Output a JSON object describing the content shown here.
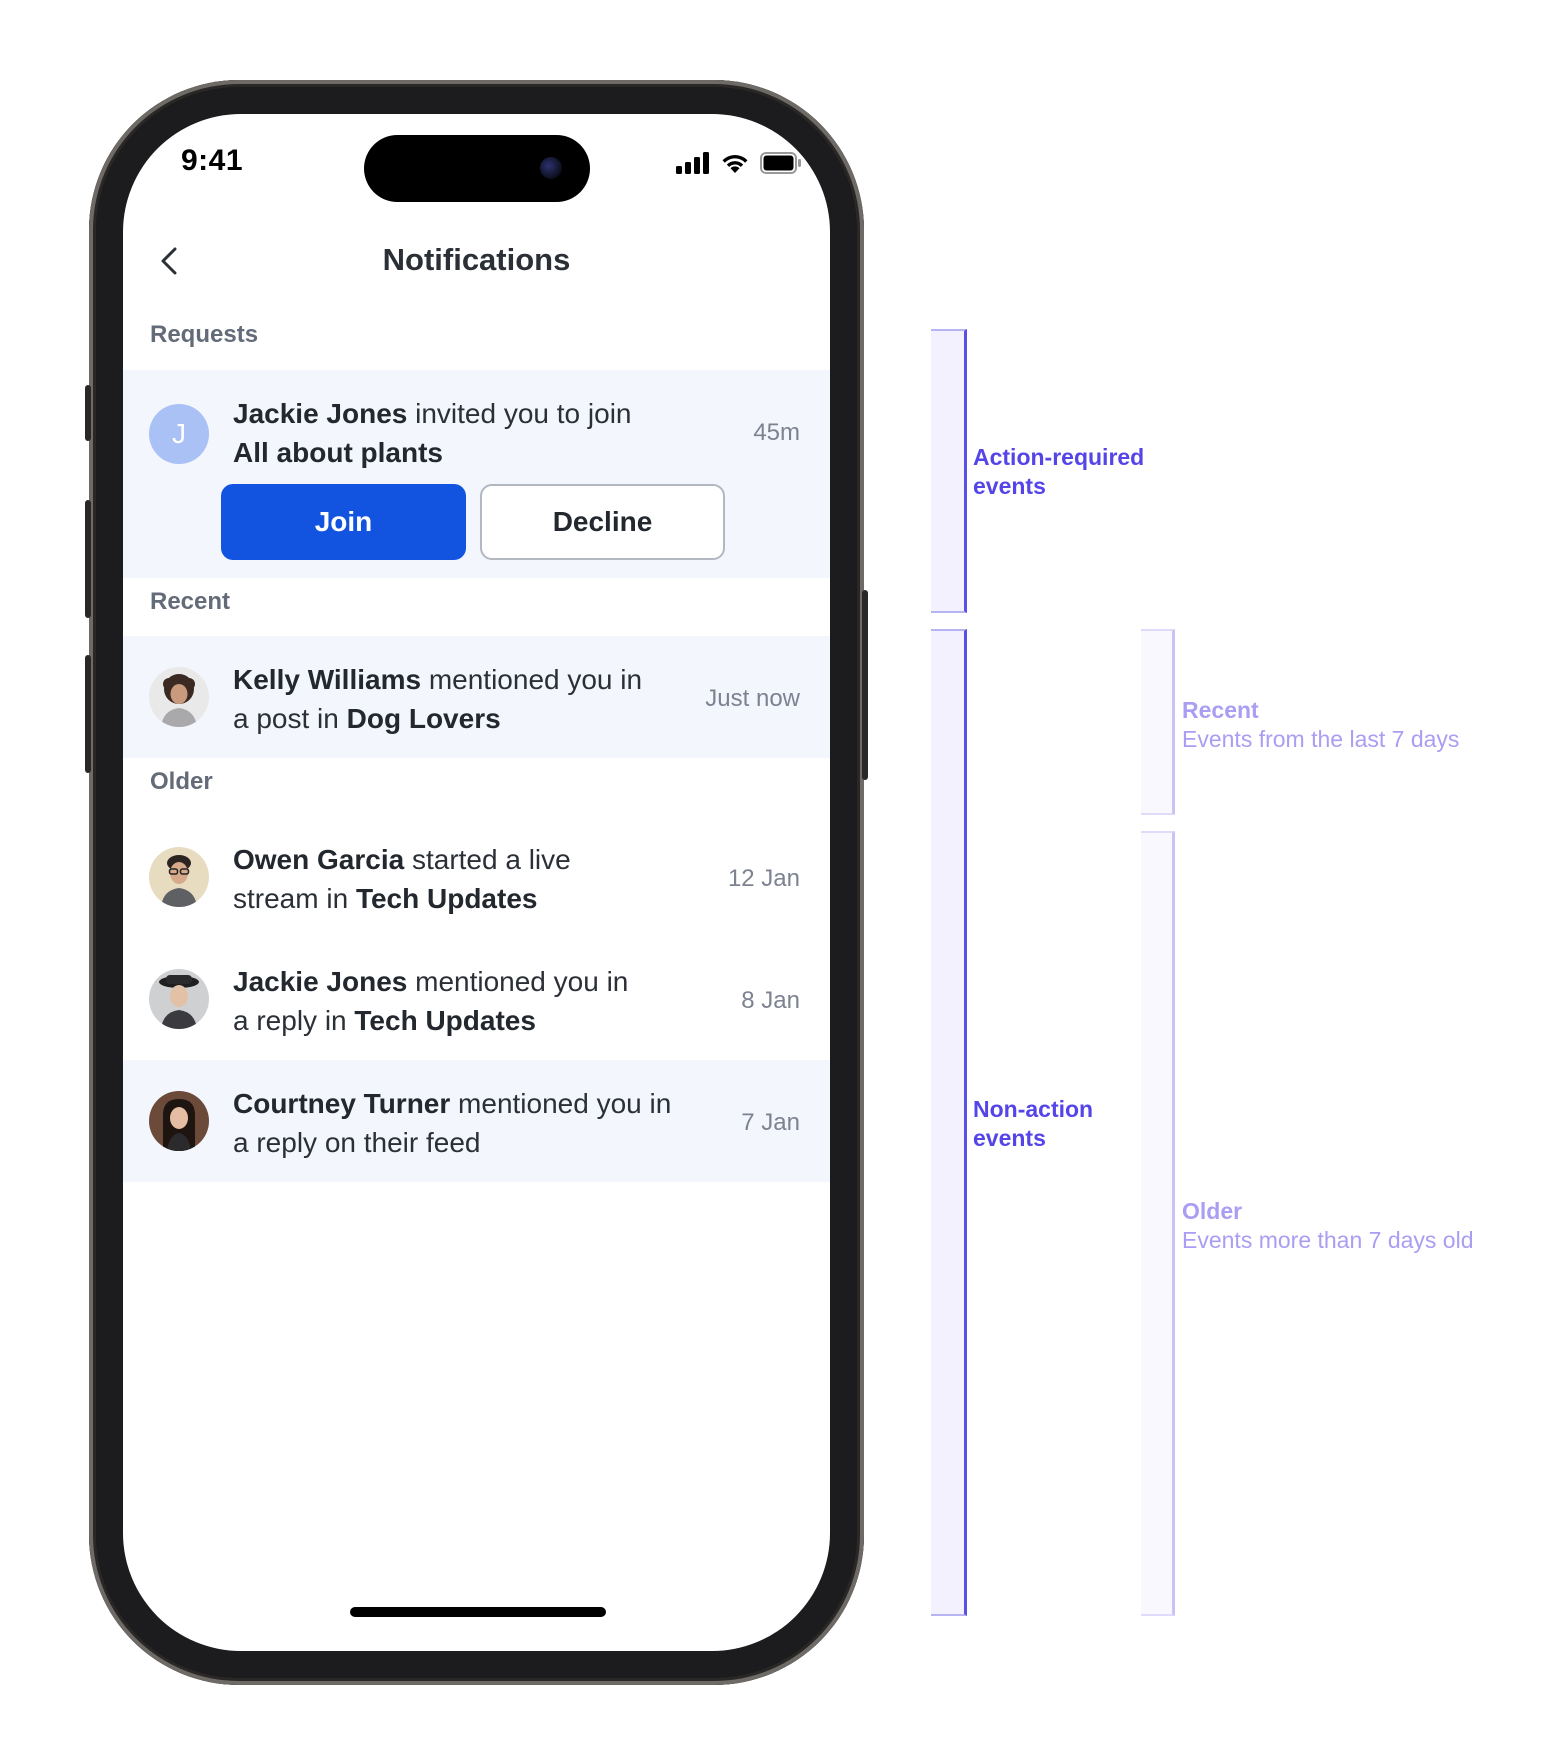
{
  "status_bar": {
    "time": "9:41"
  },
  "header": {
    "title": "Notifications"
  },
  "sections": {
    "requests": "Requests",
    "recent": "Recent",
    "older": "Older"
  },
  "request": {
    "avatar_initial": "J",
    "actor": "Jackie Jones",
    "text": " invited you to join ",
    "target": "All about plants",
    "time": "45m",
    "join_label": "Join",
    "decline_label": "Decline"
  },
  "recent_items": [
    {
      "actor": "Kelly Williams",
      "text": " mentioned you in a post in ",
      "target": "Dog Lovers",
      "time": "Just now"
    }
  ],
  "older_items": [
    {
      "actor": "Owen Garcia",
      "text": " started a live stream in ",
      "target": "Tech Updates",
      "time": "12 Jan"
    },
    {
      "actor": "Jackie Jones",
      "text": " mentioned you in a reply in ",
      "target": "Tech Updates",
      "time": "8 Jan"
    },
    {
      "actor": "Courtney Turner",
      "text": " mentioned you in a reply on their feed",
      "target": "",
      "time": "7 Jan"
    }
  ],
  "annotations": {
    "action_required": [
      "Action-required",
      "events"
    ],
    "non_action": [
      "Non-action",
      "events"
    ],
    "recent": {
      "title": "Recent",
      "subtitle": "Events from the last 7 days"
    },
    "older": {
      "title": "Older",
      "subtitle": "Events more than 7 days old"
    }
  },
  "colors": {
    "primary_button": "#1254e0",
    "highlight_background": "#f3f6fd",
    "annotation_strong": "#5545e8",
    "annotation_light": "#a99ef3"
  }
}
